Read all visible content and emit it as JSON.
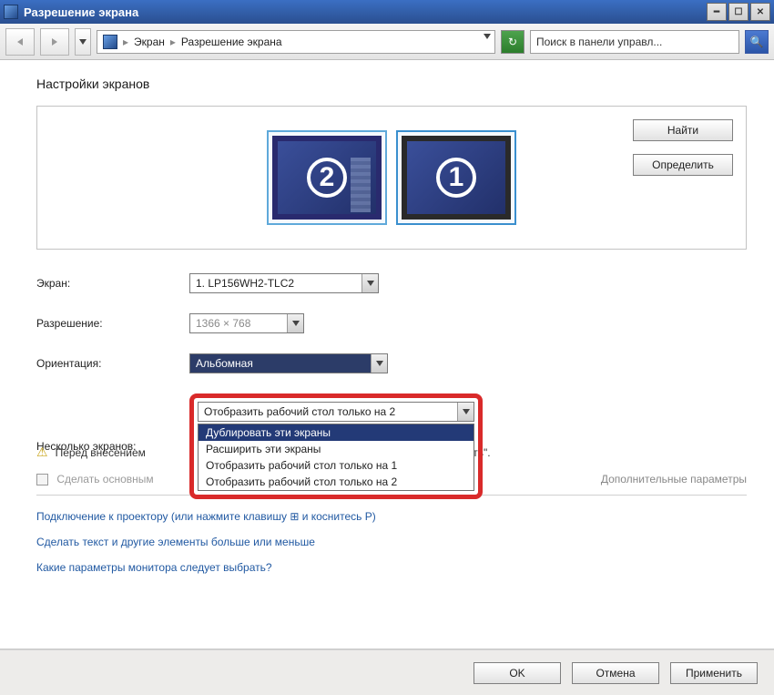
{
  "title": "Разрешение экрана",
  "breadcrumb": {
    "root": "Экран",
    "current": "Разрешение экрана"
  },
  "search": {
    "placeholder": "Поиск в панели управл..."
  },
  "heading": "Настройки экранов",
  "buttons": {
    "find": "Найти",
    "detect": "Определить",
    "ok": "OK",
    "cancel": "Отмена",
    "apply": "Применить"
  },
  "screens": {
    "n2": "2",
    "n1": "1"
  },
  "labels": {
    "screen": "Экран:",
    "resolution": "Разрешение:",
    "orientation": "Ориентация:",
    "multiple": "Несколько экранов:"
  },
  "values": {
    "screen": "1. LP156WH2-TLC2",
    "resolution": "1366 × 768",
    "orientation": "Альбомная",
    "multiple": "Отобразить рабочий стол только на 2"
  },
  "options": {
    "o1": "Дублировать эти экраны",
    "o2": "Расширить эти экраны",
    "o3": "Отобразить рабочий стол только на 1",
    "o4": "Отобразить рабочий стол только на 2"
  },
  "warning_prefix": "Перед внесением",
  "warning_suffix": "нить\".",
  "make_main": "Сделать основным",
  "advanced": "Дополнительные параметры",
  "links": {
    "projector_before": "Подключение к проектору (или нажмите клавишу ",
    "projector_after": " и коснитесь P)",
    "textsize": "Сделать текст и другие элементы больше или меньше",
    "whatparams": "Какие параметры монитора следует выбрать?"
  }
}
